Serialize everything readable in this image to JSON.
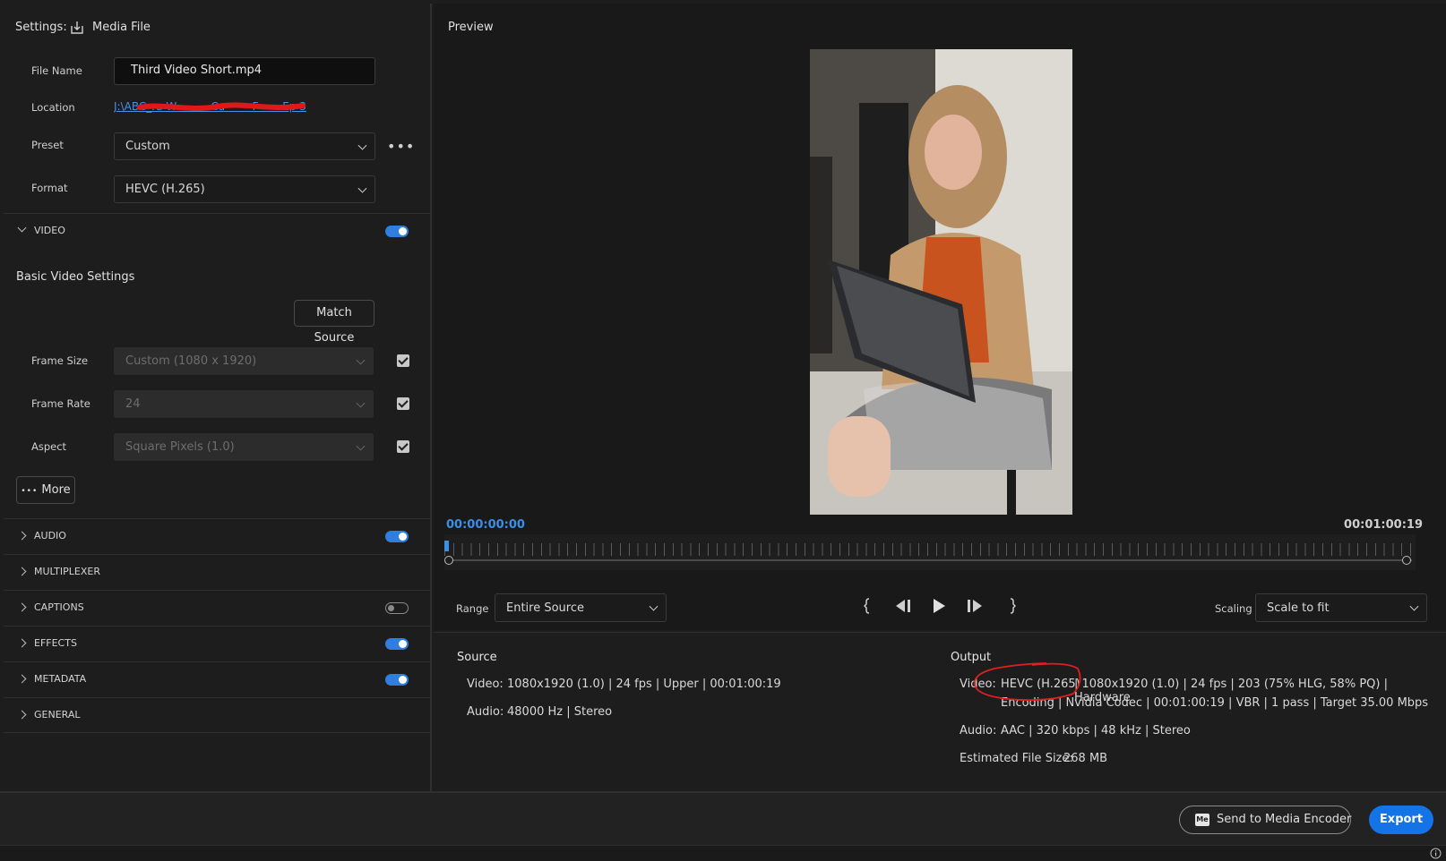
{
  "settings": {
    "label": "Settings:",
    "destination": "Media File",
    "file_name_label": "File Name",
    "file_name_value": "Third Video Short.mp4",
    "location_label": "Location",
    "location_value": "J:\\ABC_ra W          Ca        F       Ep 3\\",
    "preset_label": "Preset",
    "preset_value": "Custom",
    "format_label": "Format",
    "format_value": "HEVC (H.265)"
  },
  "video": {
    "section_title": "VIDEO",
    "enabled": true,
    "basic_title": "Basic Video Settings",
    "match_source": "Match Source",
    "frame_size_label": "Frame Size",
    "frame_size_value": "Custom (1080 x 1920)",
    "frame_rate_label": "Frame Rate",
    "frame_rate_value": "24",
    "aspect_label": "Aspect",
    "aspect_value": "Square Pixels (1.0)",
    "more_label": "More"
  },
  "sections": {
    "audio": "AUDIO",
    "multiplexer": "MULTIPLEXER",
    "captions": "CAPTIONS",
    "effects": "EFFECTS",
    "metadata": "METADATA",
    "general": "GENERAL"
  },
  "preview": {
    "title": "Preview",
    "current_time": "00:00:00:00",
    "duration": "00:01:00:19",
    "range_label": "Range",
    "range_value": "Entire Source",
    "scaling_label": "Scaling",
    "scaling_value": "Scale to fit"
  },
  "source": {
    "title": "Source",
    "video_label": "Video:",
    "video_value": "1080x1920 (1.0) | 24 fps | Upper | 00:01:00:19",
    "audio_label": "Audio:",
    "audio_value": "48000 Hz | Stereo"
  },
  "output": {
    "title": "Output",
    "video_label": "Video:",
    "video_line1_codec": "HEVC (H.265)",
    "video_line1_rest": "| 1080x1920 (1.0) | 24 fps | 203 (75% HLG, 58% PQ) | Hardware",
    "video_line2": "Encoding | Nvidia Codec | 00:01:00:19 | VBR | 1 pass | Target 35.00 Mbps",
    "audio_label": "Audio:",
    "audio_value": "AAC | 320 kbps | 48 kHz | Stereo",
    "size_label": "Estimated File Size:",
    "size_value": "268 MB"
  },
  "footer": {
    "media_encoder_badge": "Me",
    "send_label": "Send to Media Encoder",
    "export_label": "Export"
  },
  "colors": {
    "accent": "#2f7fe0",
    "timecode": "#3b8fe8",
    "annotation": "#e02020"
  },
  "icons": [
    "export-icon",
    "more-icon",
    "chevron-down-icon",
    "chevron-right-icon",
    "mark-in-icon",
    "step-back-icon",
    "play-icon",
    "step-forward-icon",
    "mark-out-icon",
    "info-icon"
  ]
}
